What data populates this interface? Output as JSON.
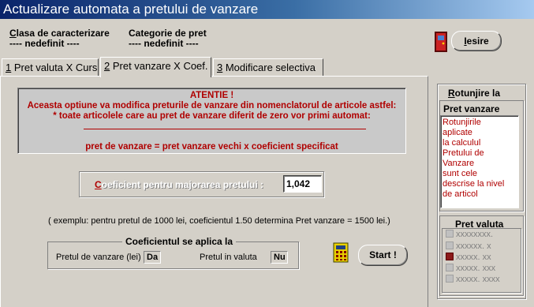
{
  "window": {
    "title": "Actualizare automata a pretului de vanzare"
  },
  "header": {
    "clasa_label": "Clasa de caracterizare",
    "clasa_value": "---- nedefinit ----",
    "categorie_label": "Categorie de pret",
    "categorie_value": "---- nedefinit ----"
  },
  "exit_button": {
    "label": "Iesire",
    "icon": "door-exit-icon"
  },
  "tabs": [
    {
      "key": "1",
      "label": " Pret valuta X Curs",
      "active": false
    },
    {
      "key": "2",
      "label": " Pret vanzare X Coef.",
      "active": true
    },
    {
      "key": "3",
      "label": " Modificare selectiva",
      "active": false
    }
  ],
  "warning": {
    "title": "ATENTIE !",
    "line1": "Aceasta optiune va modifica preturile de vanzare din nomenclatorul de articole astfel:",
    "line2": "* toate articolele care au pret de vanzare diferit de zero vor primi automat:",
    "formula": "pret de vanzare = pret vanzare vechi x coeficient specificat",
    "color": "#b00000"
  },
  "coef": {
    "label_first": "C",
    "label_rest": "oeficient pentru majorarea pretului   :",
    "value": "1,042"
  },
  "example_text": "( exemplu: pentru pretul de 1000 lei, coeficientul 1.50 determina Pret vanzare = 1500 lei.)",
  "apply": {
    "legend": "Coeficientul se aplica la",
    "pret_vanzare_label": "Pretul de vanzare (lei)",
    "pret_vanzare_value": "Da",
    "pret_valuta_label": "Pretul in valuta",
    "pret_valuta_value": "Nu"
  },
  "start_button": {
    "label": "Start !",
    "icon": "calculator-icon"
  },
  "rotunjire": {
    "title_first": "R",
    "title_rest": "otunjire la",
    "pret_vanzare_title": "Pret vanzare",
    "lines": [
      "Rotunjirile",
      "aplicate",
      "la calculul",
      "Pretului de",
      "Vanzare",
      "sunt cele",
      "descrise la nivel",
      "de articol"
    ]
  },
  "pret_valuta": {
    "title": "Pret valuta",
    "options": [
      {
        "label": "xxxxxxxx.",
        "checked": false
      },
      {
        "label": "xxxxxx. x",
        "checked": false
      },
      {
        "label": "xxxxx. xx",
        "checked": true
      },
      {
        "label": "xxxxx. xxx",
        "checked": false
      },
      {
        "label": "xxxxx. xxxx",
        "checked": false
      }
    ]
  }
}
